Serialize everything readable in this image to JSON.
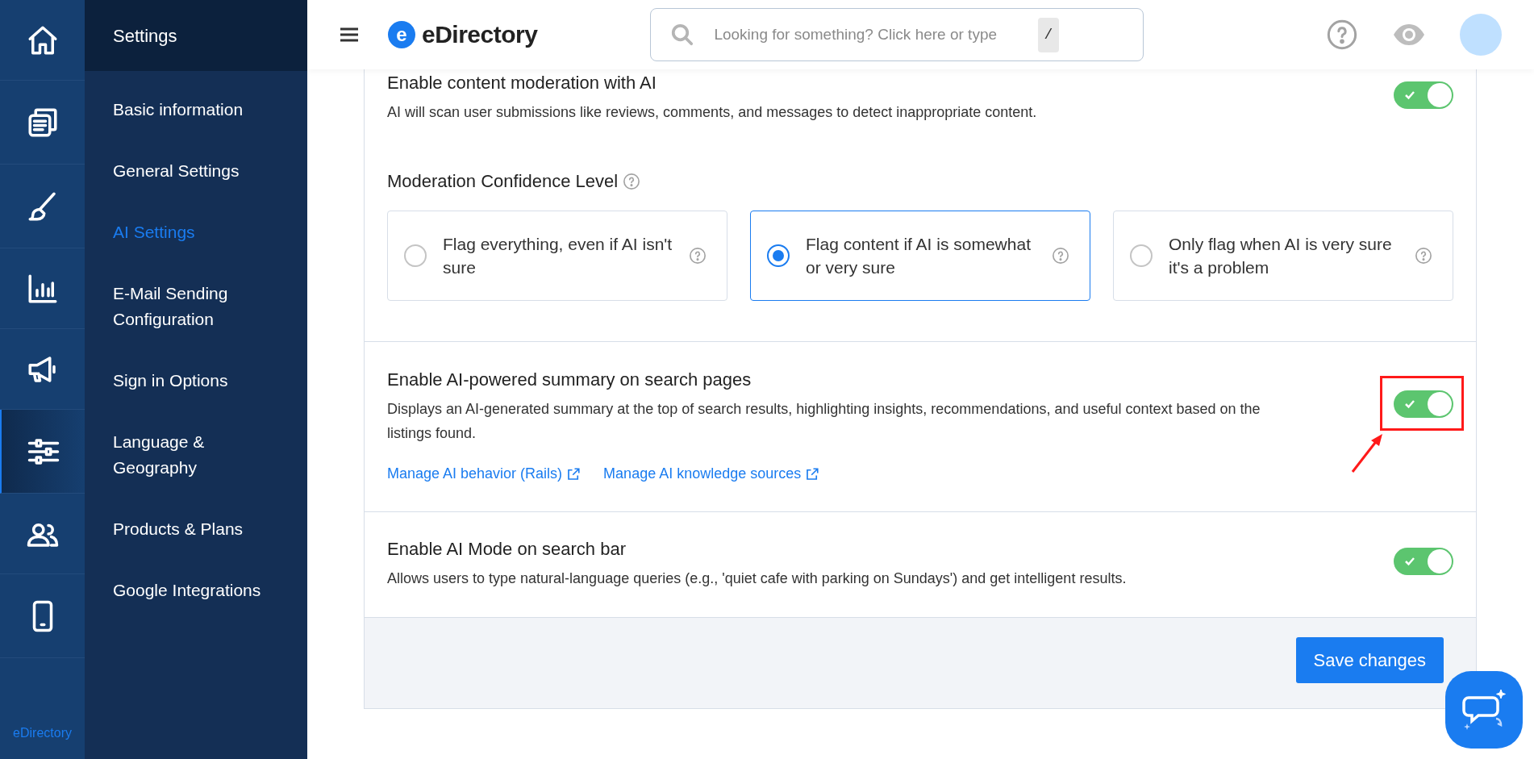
{
  "rail": {
    "items": [
      {
        "selected": false
      },
      {
        "selected": false
      },
      {
        "selected": false
      },
      {
        "selected": false
      },
      {
        "selected": false
      },
      {
        "selected": true
      },
      {
        "selected": false
      },
      {
        "selected": false
      }
    ],
    "brand": "eDirectory"
  },
  "submenu": {
    "title": "Settings",
    "items": [
      {
        "label": "Basic information",
        "selected": false
      },
      {
        "label": "General Settings",
        "selected": false
      },
      {
        "label": "AI Settings",
        "selected": true
      },
      {
        "label": "E-Mail Sending Configuration",
        "selected": false
      },
      {
        "label": "Sign in Options",
        "selected": false
      },
      {
        "label": "Language & Geography",
        "selected": false
      },
      {
        "label": "Products & Plans",
        "selected": false
      },
      {
        "label": "Google Integrations",
        "selected": false
      }
    ]
  },
  "header": {
    "logo_mark": "e",
    "logo_text": "eDirectory",
    "search": {
      "placeholder": "Looking for something? Click here or type",
      "shortcut": "/"
    }
  },
  "content": {
    "sections": [
      {
        "title": "Enable content moderation with AI",
        "description": "AI will scan user submissions like reviews, comments, and messages to detect inappropriate content.",
        "on": true,
        "highlighted": false,
        "confidence": {
          "label": "Moderation Confidence Level",
          "options": [
            {
              "label": "Flag everything, even if AI isn't sure",
              "selected": false
            },
            {
              "label": "Flag content if AI is somewhat or very sure",
              "selected": true
            },
            {
              "label": "Only flag when AI is very sure it's a problem",
              "selected": false
            }
          ]
        }
      },
      {
        "title": "Enable AI-powered summary on search pages",
        "description": "Displays an AI-generated summary at the top of search results, highlighting insights, recommendations, and useful context based on the listings found.",
        "on": true,
        "highlighted": true,
        "links": [
          "Manage AI behavior (Rails)",
          "Manage AI knowledge sources"
        ]
      },
      {
        "title": "Enable AI Mode on search bar",
        "description": "Allows users to type natural-language queries (e.g., 'quiet cafe with parking on Sundays') and get intelligent results.",
        "on": true,
        "highlighted": false
      }
    ],
    "save_button": "Save changes"
  }
}
